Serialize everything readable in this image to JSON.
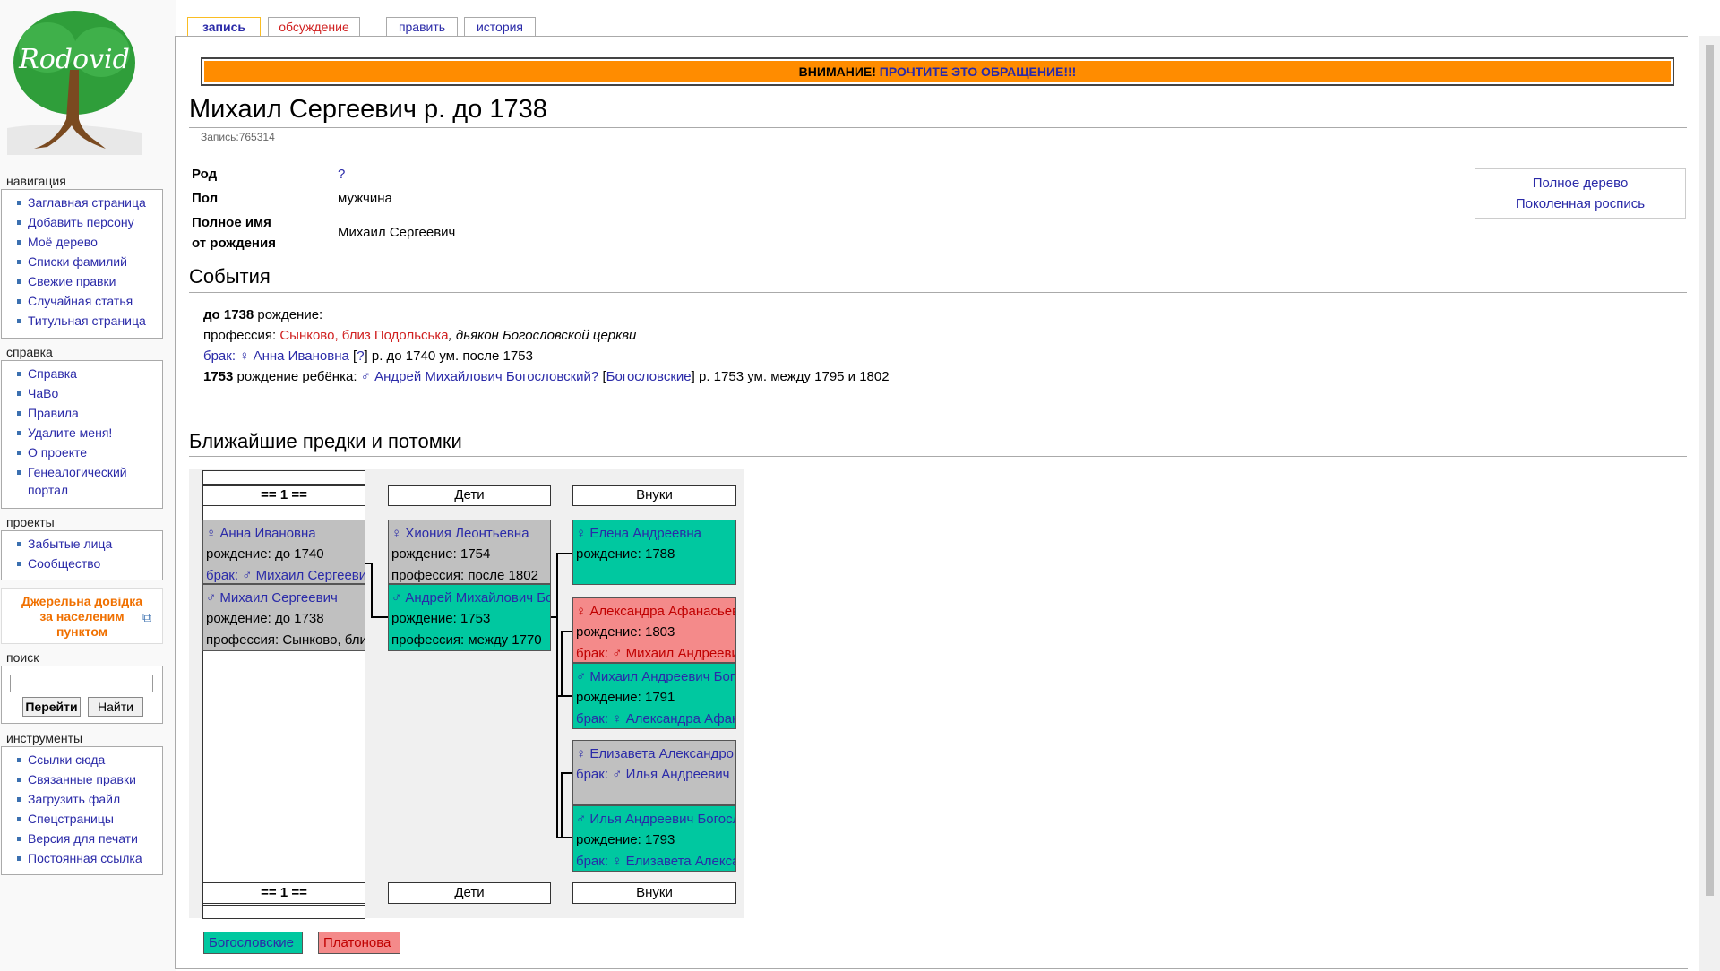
{
  "logo": {
    "text": "Rodovid"
  },
  "tabs": [
    "запись",
    "обсуждение",
    "править",
    "история"
  ],
  "notice": {
    "prefix": "ВНИМАНИЕ!",
    "link": "ПРОЧТИТЕ ЭТО ОБРАЩЕНИЕ!!!"
  },
  "page": {
    "title": "Михаил Сергеевич р. до 1738",
    "subtitle": "Запись:765314"
  },
  "info": {
    "rod_label": "Род",
    "rod_value": "?",
    "pol_label": "Пол",
    "pol_value": "мужчина",
    "name_label_1": "Полное имя",
    "name_label_2": "от рождения",
    "name_value": "Михаил Сергеевич"
  },
  "tree_links": {
    "full_tree": "Полное дерево",
    "pokolennaya": "Поколенная роспись"
  },
  "events": {
    "heading": "События",
    "e1_year": "до 1738",
    "e1_text": " рождение:",
    "e2_label": "профессия: ",
    "e2_place1": "Сынково",
    "e2_sep": ", ",
    "e2_place2": "близ Подольська",
    "e2_desc": ", дьякон Богословской церкви",
    "e3_label": "брак: ",
    "e3_person": "♀ Анна Ивановна",
    "e3_q": "?",
    "e3_dates": " р. до 1740 ум. после 1753",
    "e4_year": "1753",
    "e4_text": " рождение ребёнка: ",
    "e4_person": "♂ Андрей Михайлович Богословский?",
    "e4_rod": "Богословские",
    "e4_dates": " р. 1753 ум. между 1795 и 1802"
  },
  "tree": {
    "heading": "Ближайшие предки и потомки",
    "h_gen": "== 1 ==",
    "h_children": "Дети",
    "h_grand": "Внуки",
    "f_gen": "== 1 ==",
    "f_children": "Дети",
    "f_grand": "Внуки",
    "anna": {
      "name": "♀ Анна Ивановна",
      "l2": "рождение: до 1740",
      "l3": "брак: ♂ Михаил Сергеевич"
    },
    "mikhail": {
      "name": "♂ Михаил Сергеевич",
      "l2": "рождение: до 1738",
      "l3": "профессия: Сынково, близ Подольська"
    },
    "khioniya": {
      "name": "♀ Хиония Леонтьевна",
      "l2": "рождение: 1754",
      "l3": "профессия: после 1802"
    },
    "andrey": {
      "name": "♂ Андрей Михайлович Богословский",
      "l2": "рождение: 1753",
      "l3": "профессия: между 1770"
    },
    "elena": {
      "name": "♀ Елена Андреевна",
      "l2": "рождение: 1788"
    },
    "aleksandra": {
      "name": "♀ Александра Афанасьевна",
      "l2": "рождение: 1803",
      "l3": "брак: ♂ Михаил Андреевич"
    },
    "mikhail2": {
      "name": "♂ Михаил Андреевич Богословский",
      "l2": "рождение: 1791",
      "l3": "брак: ♀ Александра Афанасьевна"
    },
    "elizaveta": {
      "name": "♀ Елизавета Александровна",
      "l2": "брак: ♂ Илья Андреевич"
    },
    "ilya": {
      "name": "♂ Илья Андреевич Богословский",
      "l2": "рождение: 1793",
      "l3": "брак: ♀ Елизавета Александровна"
    }
  },
  "legend": {
    "bogoslovskie": "Богословские",
    "platonova": "Платонова"
  },
  "sidebar": {
    "nav_title": "навигация",
    "nav": [
      "Заглавная страница",
      "Добавить персону",
      "Моё дерево",
      "Списки фамилий",
      "Свежие правки",
      "Случайная статья",
      "Титульная страница"
    ],
    "help_title": "справка",
    "help": [
      "Справка",
      "ЧаВо",
      "Правила",
      "Удалите меня!",
      "О проекте"
    ],
    "help_multi_1": "Генеалогический",
    "help_multi_2": "портал",
    "proj_title": "проекты",
    "proj": [
      "Забытые лица",
      "Сообщество"
    ],
    "promo_1": "Джерельна довідка",
    "promo_2": "за населеним",
    "promo_3": "пунктом",
    "search_title": "поиск",
    "search_go": "Перейти",
    "search_find": "Найти",
    "tools_title": "инструменты",
    "tools": [
      "Ссылки сюда",
      "Связанные правки",
      "Загрузить файл",
      "Спецстраницы",
      "Версия для печати",
      "Постоянная ссылка"
    ]
  },
  "colors": {
    "teal": "#00c8a0",
    "pink": "#f48a8a",
    "gray": "#c0c0c0",
    "notice": "#ff8c00",
    "tab_active": "#fabd23"
  }
}
